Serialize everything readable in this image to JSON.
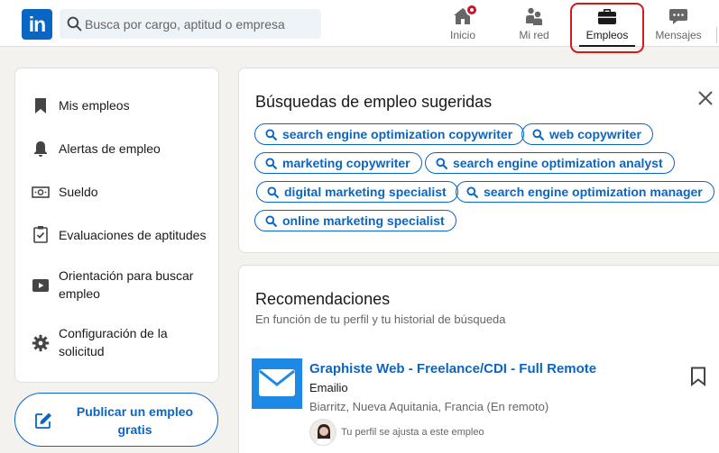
{
  "header": {
    "logo_text": "in",
    "search_placeholder": "Busca por cargo, aptitud o empresa",
    "nav": [
      {
        "label": "Inicio",
        "icon": "home-icon"
      },
      {
        "label": "Mi red",
        "icon": "people-icon"
      },
      {
        "label": "Empleos",
        "icon": "briefcase-icon",
        "active": true
      },
      {
        "label": "Mensajes",
        "icon": "chat-icon"
      }
    ]
  },
  "sidebar": {
    "items": [
      {
        "label": "Mis empleos",
        "icon": "bookmark-icon"
      },
      {
        "label": "Alertas de empleo",
        "icon": "bell-icon"
      },
      {
        "label": "Sueldo",
        "icon": "money-icon"
      },
      {
        "label": "Evaluaciones de aptitudes",
        "icon": "clipboard-check-icon"
      },
      {
        "label": "Orientación para buscar empleo",
        "icon": "video-icon"
      },
      {
        "label": "Configuración de la solicitud",
        "icon": "gear-icon"
      }
    ],
    "post_job_label": "Publicar un empleo gratis"
  },
  "suggestions": {
    "title": "Búsquedas de empleo sugeridas",
    "items": [
      "search engine optimization copywriter",
      "web copywriter",
      "marketing copywriter",
      "search engine optimization analyst",
      "digital marketing specialist",
      "search engine optimization manager",
      "online marketing specialist"
    ]
  },
  "recommendations": {
    "title": "Recomendaciones",
    "subtitle": "En función de tu perfil y tu historial de búsqueda",
    "job": {
      "title": "Graphiste Web - Freelance/CDI - Full Remote",
      "company": "Emailio",
      "location": "Biarritz, Nueva Aquitania, Francia (En remoto)",
      "match": "Tu perfil se ajusta a este empleo"
    }
  },
  "colors": {
    "brand": "#0a66c2",
    "notification": "#cb112d",
    "highlight_box": "#d11a1a"
  }
}
